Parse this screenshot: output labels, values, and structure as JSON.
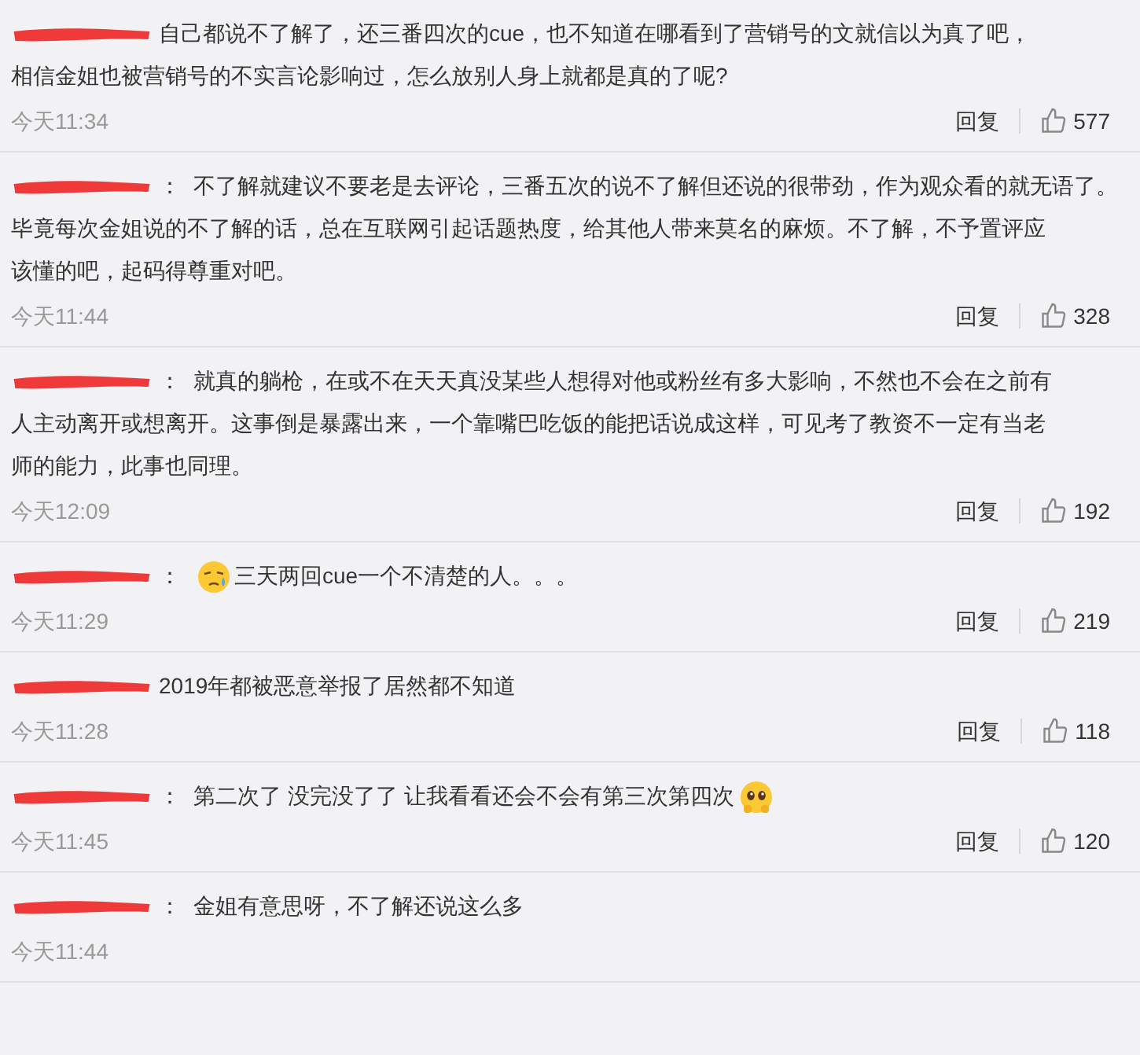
{
  "comments": [
    {
      "lines": [
        "自己都说不了解了，还三番四次的cue，也不知道在哪看到了营销号的文就信以为真了吧，",
        "相信金姐也被营销号的不实言论影响过，怎么放别人身上就都是真的了呢?"
      ],
      "time": "今天11:34",
      "reply": "回复",
      "likes": "577"
    },
    {
      "separator": "：",
      "lines": [
        "不了解就建议不要老是去评论，三番五次的说不了解但还说的很带劲，作为观众看的就无语了。",
        "毕竟每次金姐说的不了解的话，总在互联网引起话题热度，给其他人带来莫名的麻烦。不了解，不予置评应",
        "该懂的吧，起码得尊重对吧。"
      ],
      "time": "今天11:44",
      "reply": "回复",
      "likes": "328"
    },
    {
      "separator": "：",
      "lines": [
        "就真的躺枪，在或不在天天真没某些人想得对他或粉丝有多大影响，不然也不会在之前有",
        "人主动离开或想离开。这事倒是暴露出来，一个靠嘴巴吃饭的能把话说成这样，可见考了教资不一定有当老",
        "师的能力，此事也同理。"
      ],
      "time": "今天12:09",
      "reply": "回复",
      "likes": "192"
    },
    {
      "separator": "：",
      "leading_emoji": {
        "kind": "sweat"
      },
      "lines": [
        "三天两回cue一个不清楚的人。。。"
      ],
      "time": "今天11:29",
      "reply": "回复",
      "likes": "219"
    },
    {
      "lines": [
        "2019年都被恶意举报了居然都不知道"
      ],
      "time": "今天11:28",
      "reply": "回复",
      "likes": "118"
    },
    {
      "separator": "：",
      "trailing_emoji": {
        "kind": "pleading"
      },
      "lines": [
        "第二次了 没完没了了 让我看看还会不会有第三次第四次"
      ],
      "time": "今天11:45",
      "reply": "回复",
      "likes": "120"
    },
    {
      "separator": "：",
      "lines": [
        "金姐有意思呀，不了解还说这么多"
      ],
      "time": "今天11:44"
    }
  ]
}
